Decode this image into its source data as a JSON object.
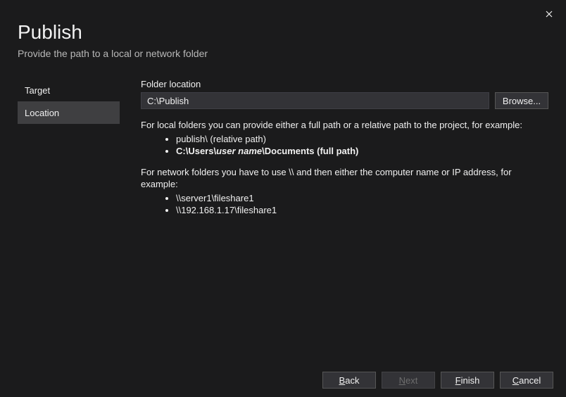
{
  "header": {
    "title": "Publish",
    "subtitle": "Provide the path to a local or network folder"
  },
  "sidebar": {
    "items": [
      {
        "label": "Target"
      },
      {
        "label": "Location"
      }
    ]
  },
  "form": {
    "folder_label": "Folder location",
    "folder_value": "C:\\Publish",
    "browse_label": "Browse..."
  },
  "help": {
    "local_intro": "For local folders you can provide either a full path or a relative path to the project, for example:",
    "local_ex1": "publish\\ (relative path)",
    "local_ex2_prefix": "C:\\Users\\",
    "local_ex2_var": "user name",
    "local_ex2_suffix": "\\Documents (full path)",
    "network_intro": "For network folders you have to use \\\\ and then either the computer name or IP address, for example:",
    "network_ex1": "\\\\server1\\fileshare1",
    "network_ex2": "\\\\192.168.1.17\\fileshare1"
  },
  "footer": {
    "back": "ack",
    "back_mn": "B",
    "next": "ext",
    "next_mn": "N",
    "finish": "inish",
    "finish_mn": "F",
    "cancel": "ancel",
    "cancel_mn": "C"
  }
}
